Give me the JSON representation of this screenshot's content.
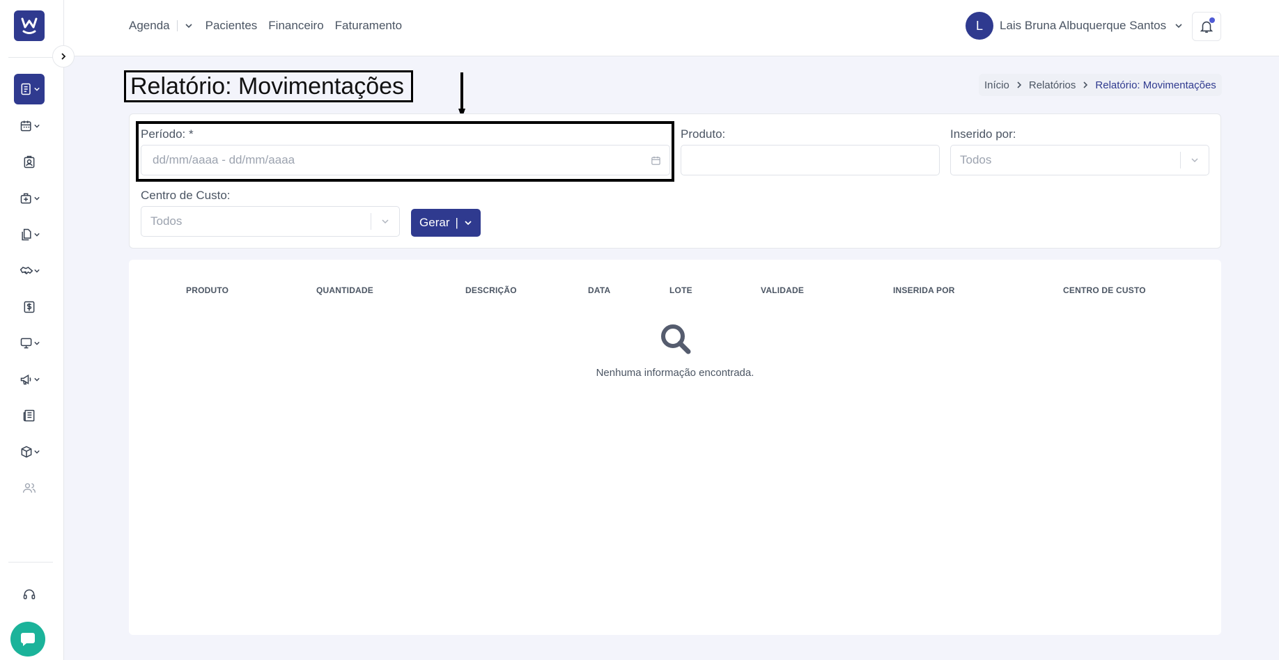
{
  "nav": {
    "items": [
      "Agenda",
      "Pacientes",
      "Financeiro",
      "Faturamento"
    ]
  },
  "user": {
    "initial": "L",
    "name": "Lais Bruna Albuquerque Santos"
  },
  "page": {
    "title": "Relatório: Movimentações"
  },
  "breadcrumb": [
    "Início",
    "Relatórios",
    "Relatório: Movimentações"
  ],
  "filters": {
    "periodo_label": "Período: *",
    "periodo_placeholder": "dd/mm/aaaa - dd/mm/aaaa",
    "produto_label": "Produto:",
    "produto_value": "",
    "inserido_label": "Inserido por:",
    "inserido_value": "Todos",
    "centro_label": "Centro de Custo:",
    "centro_value": "Todos",
    "gerar_label": "Gerar",
    "gerar_separator": "|"
  },
  "table": {
    "columns": [
      "PRODUTO",
      "QUANTIDADE",
      "DESCRIÇÃO",
      "DATA",
      "LOTE",
      "VALIDADE",
      "INSERIDA POR",
      "CENTRO DE CUSTO"
    ],
    "empty_message": "Nenhuma informação encontrada."
  },
  "colors": {
    "primary": "#2f3a8f",
    "chat": "#1bb39a",
    "notification_dot": "#4f5bd5"
  },
  "icons": {
    "sidebar": [
      "report-icon",
      "calendar-icon",
      "patient-badge-icon",
      "medical-kit-icon",
      "documents-icon",
      "handshake-icon",
      "dollar-icon",
      "monitor-icon",
      "megaphone-icon",
      "newspaper-icon",
      "box-icon",
      "users-icon",
      "headset-icon"
    ]
  }
}
